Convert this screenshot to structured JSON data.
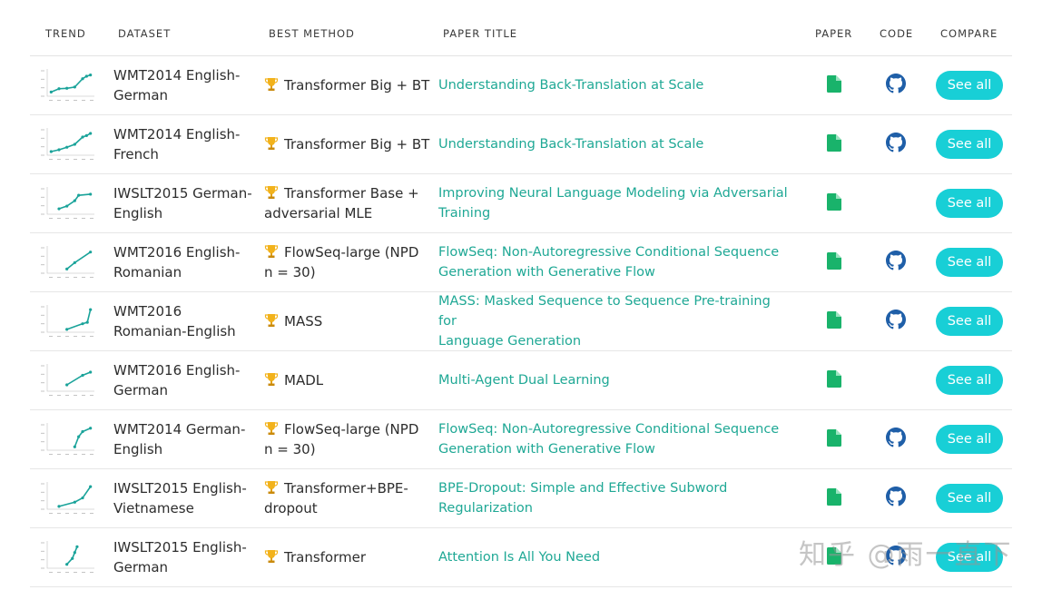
{
  "headers": {
    "trend": "TREND",
    "dataset": "DATASET",
    "best_method": "BEST METHOD",
    "paper_title": "PAPER TITLE",
    "paper": "PAPER",
    "code": "CODE",
    "compare": "COMPARE"
  },
  "colors": {
    "link": "#1fa895",
    "button": "#18cfd6",
    "paper_icon": "#19b36b",
    "code_icon": "#1f5fa8",
    "trend_line": "#1aa39a"
  },
  "rows": [
    {
      "dataset_1": "WMT2014 English-",
      "dataset_2": "German",
      "method_1": "Transformer Big + BT",
      "method_2": "",
      "title_1": "Understanding Back-Translation at Scale",
      "title_2": "",
      "has_code": true,
      "button": "See all",
      "trend": [
        [
          2014,
          25.2
        ],
        [
          2015,
          26.0
        ],
        [
          2016,
          26.1
        ],
        [
          2017,
          26.4
        ],
        [
          2018,
          28.4
        ],
        [
          2018.5,
          29.0
        ],
        [
          2019,
          29.3
        ]
      ]
    },
    {
      "dataset_1": "WMT2014 English-",
      "dataset_2": "French",
      "method_1": "Transformer Big + BT",
      "method_2": "",
      "title_1": "Understanding Back-Translation at Scale",
      "title_2": "",
      "has_code": true,
      "button": "See all",
      "trend": [
        [
          2014,
          37.0
        ],
        [
          2015,
          37.5
        ],
        [
          2016,
          38.2
        ],
        [
          2017,
          39.0
        ],
        [
          2018,
          41.0
        ],
        [
          2018.5,
          41.4
        ],
        [
          2019,
          42.0
        ]
      ]
    },
    {
      "dataset_1": "IWSLT2015 German-",
      "dataset_2": "English",
      "method_1": "Transformer Base +",
      "method_2": "adversarial MLE",
      "title_1": "Improving Neural Language Modeling via Adversarial",
      "title_2": "Training",
      "has_code": false,
      "button": "See all",
      "trend": [
        [
          2015,
          27.5
        ],
        [
          2016,
          28.0
        ],
        [
          2017,
          29.0
        ],
        [
          2017.5,
          30.0
        ],
        [
          2019,
          30.2
        ]
      ]
    },
    {
      "dataset_1": "WMT2016 English-",
      "dataset_2": "Romanian",
      "method_1": "FlowSeq-large (NPD",
      "method_2": "n = 30)",
      "title_1": "FlowSeq: Non-Autoregressive Conditional Sequence",
      "title_2": "Generation with Generative Flow",
      "has_code": true,
      "button": "See all",
      "trend": [
        [
          2016,
          28.0
        ],
        [
          2017,
          29.5
        ],
        [
          2019,
          32.0
        ]
      ]
    },
    {
      "dataset_1": "WMT2016",
      "dataset_2": "Romanian-English",
      "method_1": "MASS",
      "method_2": "",
      "title_1": "MASS: Masked Sequence to Sequence Pre-training for",
      "title_2": "Language Generation",
      "has_code": true,
      "button": "See all",
      "trend": [
        [
          2016,
          28.0
        ],
        [
          2018,
          30.0
        ],
        [
          2018.6,
          30.5
        ],
        [
          2019,
          35.0
        ]
      ]
    },
    {
      "dataset_1": "WMT2016 English-",
      "dataset_2": "German",
      "method_1": "MADL",
      "method_2": "",
      "title_1": "Multi-Agent Dual Learning",
      "title_2": "",
      "has_code": false,
      "button": "See all",
      "trend": [
        [
          2016,
          33.0
        ],
        [
          2018,
          34.5
        ],
        [
          2019,
          35.0
        ]
      ]
    },
    {
      "dataset_1": "WMT2014 German-",
      "dataset_2": "English",
      "method_1": "FlowSeq-large (NPD",
      "method_2": "n = 30)",
      "title_1": "FlowSeq: Non-Autoregressive Conditional Sequence",
      "title_2": "Generation with Generative Flow",
      "has_code": true,
      "button": "See all",
      "trend": [
        [
          2017,
          21.0
        ],
        [
          2017.5,
          24.0
        ],
        [
          2018,
          25.5
        ],
        [
          2019,
          26.5
        ]
      ]
    },
    {
      "dataset_1": "IWSLT2015 English-",
      "dataset_2": "Vietnamese",
      "method_1": "Transformer+BPE-",
      "method_2": "dropout",
      "title_1": "BPE-Dropout: Simple and Effective Subword",
      "title_2": "Regularization",
      "has_code": true,
      "button": "See all",
      "trend": [
        [
          2015,
          26.0
        ],
        [
          2017,
          27.5
        ],
        [
          2018,
          29.0
        ],
        [
          2019,
          33.0
        ]
      ]
    },
    {
      "dataset_1": "IWSLT2015 English-",
      "dataset_2": "German",
      "method_1": "Transformer",
      "method_2": "",
      "title_1": "Attention Is All You Need",
      "title_2": "",
      "has_code": true,
      "button": "See all",
      "trend": [
        [
          2016,
          25.0
        ],
        [
          2016.7,
          26.5
        ],
        [
          2017,
          28.0
        ],
        [
          2017.3,
          29.5
        ]
      ]
    }
  ],
  "watermark": "知乎 @雨一直下"
}
